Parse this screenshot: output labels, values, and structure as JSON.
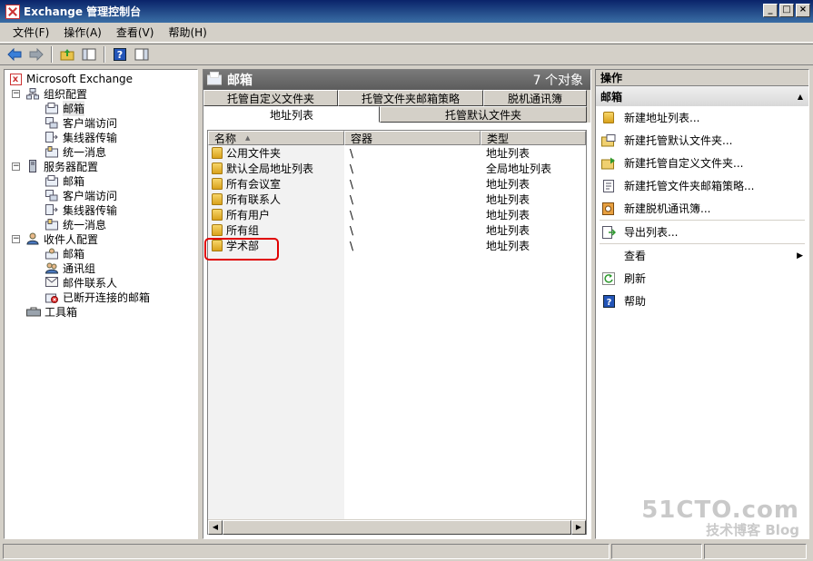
{
  "window": {
    "title": "Exchange 管理控制台",
    "controls": {
      "minimize": "_",
      "maximize": "□",
      "close": "×"
    }
  },
  "menu": [
    {
      "label": "文件(F)"
    },
    {
      "label": "操作(A)"
    },
    {
      "label": "查看(V)"
    },
    {
      "label": "帮助(H)"
    }
  ],
  "toolbar": {
    "icons": [
      "back-arrow-icon",
      "forward-arrow-icon",
      "up-folder-icon",
      "show-hide-tree-icon",
      "help-icon",
      "action-pane-icon"
    ]
  },
  "tree": {
    "root": "Microsoft Exchange",
    "expander_minus": "−",
    "groups": [
      {
        "label": "组织配置",
        "children": [
          "邮箱",
          "客户端访问",
          "集线器传输",
          "统一消息"
        ]
      },
      {
        "label": "服务器配置",
        "children": [
          "邮箱",
          "客户端访问",
          "集线器传输",
          "统一消息"
        ]
      },
      {
        "label": "收件人配置",
        "children": [
          "邮箱",
          "通讯组",
          "邮件联系人",
          "已断开连接的邮箱"
        ]
      }
    ],
    "toolbox": "工具箱",
    "selected": "组织配置/邮箱"
  },
  "center": {
    "title": "邮箱",
    "count": "7 个对象",
    "tabs_top": [
      "托管自定义文件夹",
      "托管文件夹邮箱策略",
      "脱机通讯簿"
    ],
    "tabs_bottom": [
      "地址列表",
      "托管默认文件夹"
    ],
    "active_tab": "地址列表",
    "columns": [
      "名称",
      "容器",
      "类型"
    ],
    "sort_indicator": "▲",
    "rows": [
      {
        "name": "公用文件夹",
        "container": "\\",
        "type": "地址列表"
      },
      {
        "name": "默认全局地址列表",
        "container": "\\",
        "type": "全局地址列表"
      },
      {
        "name": "所有会议室",
        "container": "\\",
        "type": "地址列表"
      },
      {
        "name": "所有联系人",
        "container": "\\",
        "type": "地址列表"
      },
      {
        "name": "所有用户",
        "container": "\\",
        "type": "地址列表"
      },
      {
        "name": "所有组",
        "container": "\\",
        "type": "地址列表"
      },
      {
        "name": "学术部",
        "container": "\\",
        "type": "地址列表"
      }
    ],
    "highlighted_row": "学术部",
    "highlight_color": "#e00000",
    "scroll_left": "◀",
    "scroll_right": "▶"
  },
  "actions": {
    "header": "操作",
    "section": "邮箱",
    "collapse": "▲",
    "items": [
      {
        "label": "新建地址列表...",
        "icon": "address-list-icon"
      },
      {
        "label": "新建托管默认文件夹...",
        "icon": "managed-default-folder-icon"
      },
      {
        "label": "新建托管自定义文件夹...",
        "icon": "managed-custom-folder-icon"
      },
      {
        "label": "新建托管文件夹邮箱策略...",
        "icon": "mailbox-policy-icon"
      },
      {
        "label": "新建脱机通讯簿...",
        "icon": "offline-address-book-icon"
      },
      {
        "label": "导出列表...",
        "icon": "export-list-icon"
      },
      {
        "label": "查看",
        "icon": "none",
        "submenu": "▶"
      },
      {
        "label": "刷新",
        "icon": "refresh-icon"
      },
      {
        "label": "帮助",
        "icon": "help-icon"
      }
    ]
  },
  "watermark": {
    "main": "51CTO.com",
    "sub": "技术博客 Blog"
  },
  "colors": {
    "title_bar": "#0a246a",
    "center_header": "#6b6b6b",
    "folder": "#e8b83a"
  }
}
